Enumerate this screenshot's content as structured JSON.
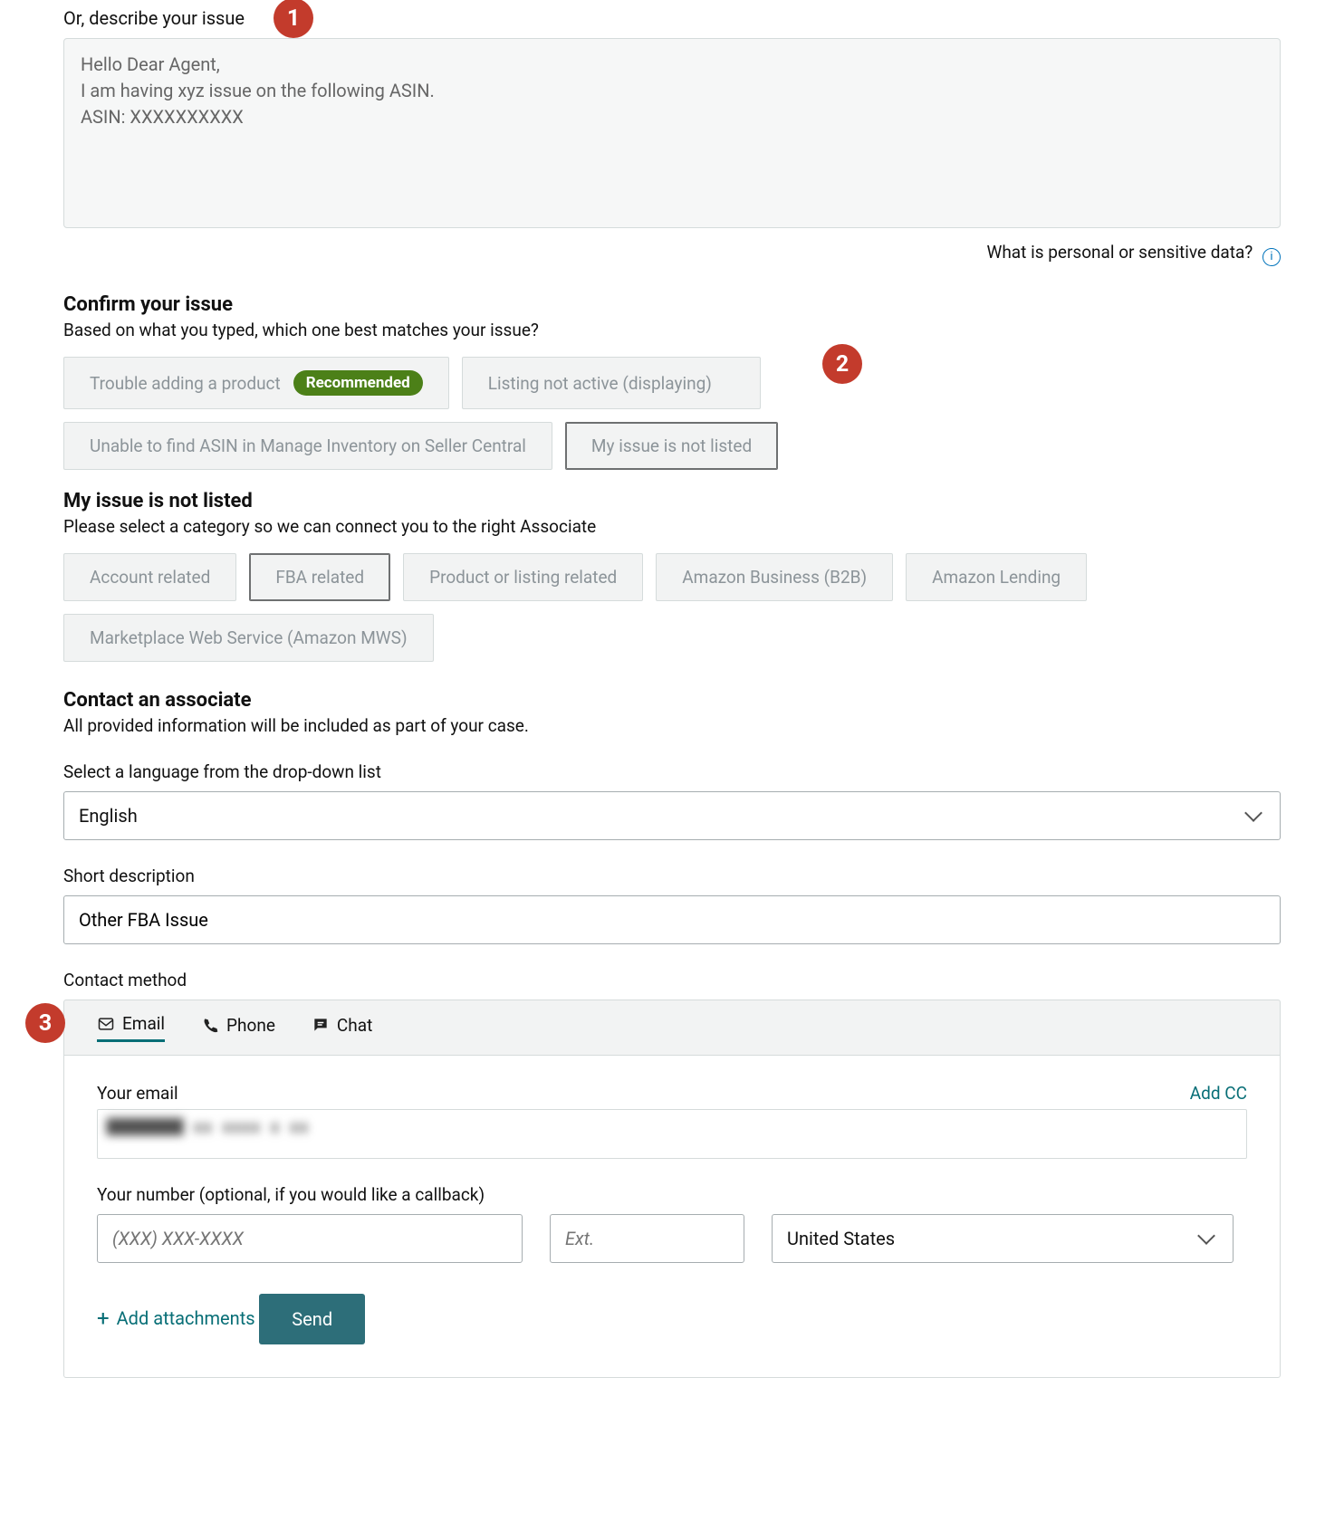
{
  "describe": {
    "label": "Or, describe your issue",
    "value": "Hello Dear Agent,\nI am having xyz issue on the following ASIN.\nASIN: XXXXXXXXXX",
    "sensitive_link": "What is personal or sensitive data?"
  },
  "annotations": {
    "1": "1",
    "2": "2",
    "3": "3"
  },
  "confirm": {
    "heading": "Confirm your issue",
    "sub": "Based on what you typed, which one best matches your issue?",
    "recommended_badge": "Recommended",
    "options": [
      "Trouble adding a product",
      "Listing not active (displaying)",
      "Unable to find ASIN in Manage Inventory on Seller Central",
      "My issue is not listed"
    ],
    "selected": "My issue is not listed"
  },
  "notlisted": {
    "heading": "My issue is not listed",
    "sub": "Please select a category so we can connect you to the right Associate",
    "options": [
      "Account related",
      "FBA related",
      "Product or listing related",
      "Amazon Business (B2B)",
      "Amazon Lending",
      "Marketplace Web Service (Amazon MWS)"
    ],
    "selected": "FBA related"
  },
  "contact": {
    "heading": "Contact an associate",
    "sub": "All provided information will be included as part of your case.",
    "lang_label": "Select a language from the drop-down list",
    "lang_value": "English",
    "short_label": "Short description",
    "short_value": "Other FBA Issue",
    "method_label": "Contact method",
    "tabs": {
      "email": "Email",
      "phone": "Phone",
      "chat": "Chat"
    },
    "email": {
      "label": "Your email",
      "add_cc": "Add CC",
      "value_masked": "████████ ▮▮ ▮▮▮▮ ▮ ▮▮"
    },
    "number": {
      "label": "Your number (optional, if you would like a callback)",
      "placeholder": "(XXX) XXX-XXXX",
      "ext_placeholder": "Ext.",
      "country": "United States"
    },
    "attach": "Add attachments",
    "send": "Send"
  }
}
